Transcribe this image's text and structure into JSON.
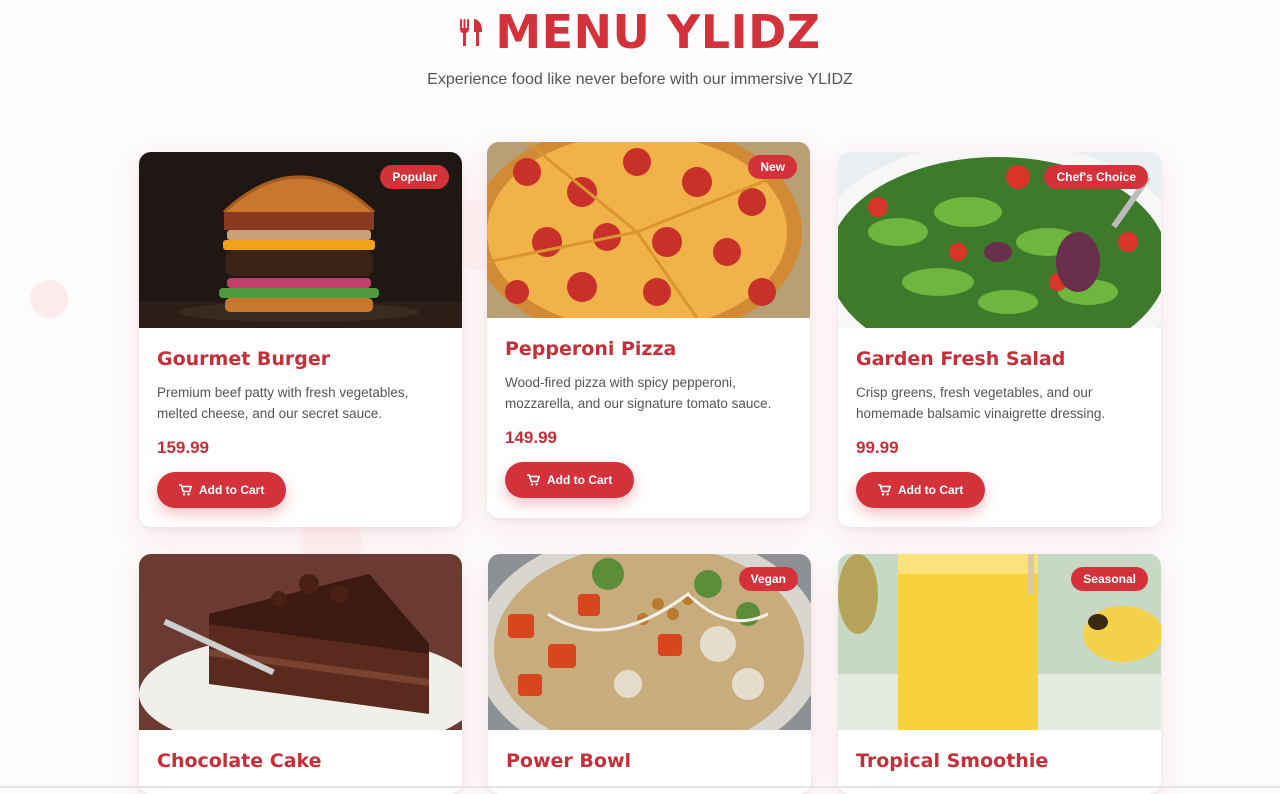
{
  "header": {
    "title": "MENU YLIDZ",
    "subtitle": "Experience food like never before with our immersive YLIDZ",
    "icon": "utensils-icon"
  },
  "colors": {
    "accent": "#d3323b",
    "price": "#c62f37",
    "background": "#fdfbfc"
  },
  "items": [
    {
      "name": "Gourmet Burger",
      "badge": "Popular",
      "description": "Premium beef patty with fresh vegetables, melted cheese, and our secret sauce.",
      "price": "159.99",
      "button": "Add to Cart"
    },
    {
      "name": "Pepperoni Pizza",
      "badge": "New",
      "description": "Wood-fired pizza with spicy pepperoni, mozzarella, and our signature tomato sauce.",
      "price": "149.99",
      "button": "Add to Cart"
    },
    {
      "name": "Garden Fresh Salad",
      "badge": "Chef's Choice",
      "description": "Crisp greens, fresh vegetables, and our homemade balsamic vinaigrette dressing.",
      "price": "99.99",
      "button": "Add to Cart"
    },
    {
      "name": "Chocolate Cake",
      "badge": ""
    },
    {
      "name": "Power Bowl",
      "badge": "Vegan"
    },
    {
      "name": "Tropical Smoothie",
      "badge": "Seasonal"
    }
  ]
}
